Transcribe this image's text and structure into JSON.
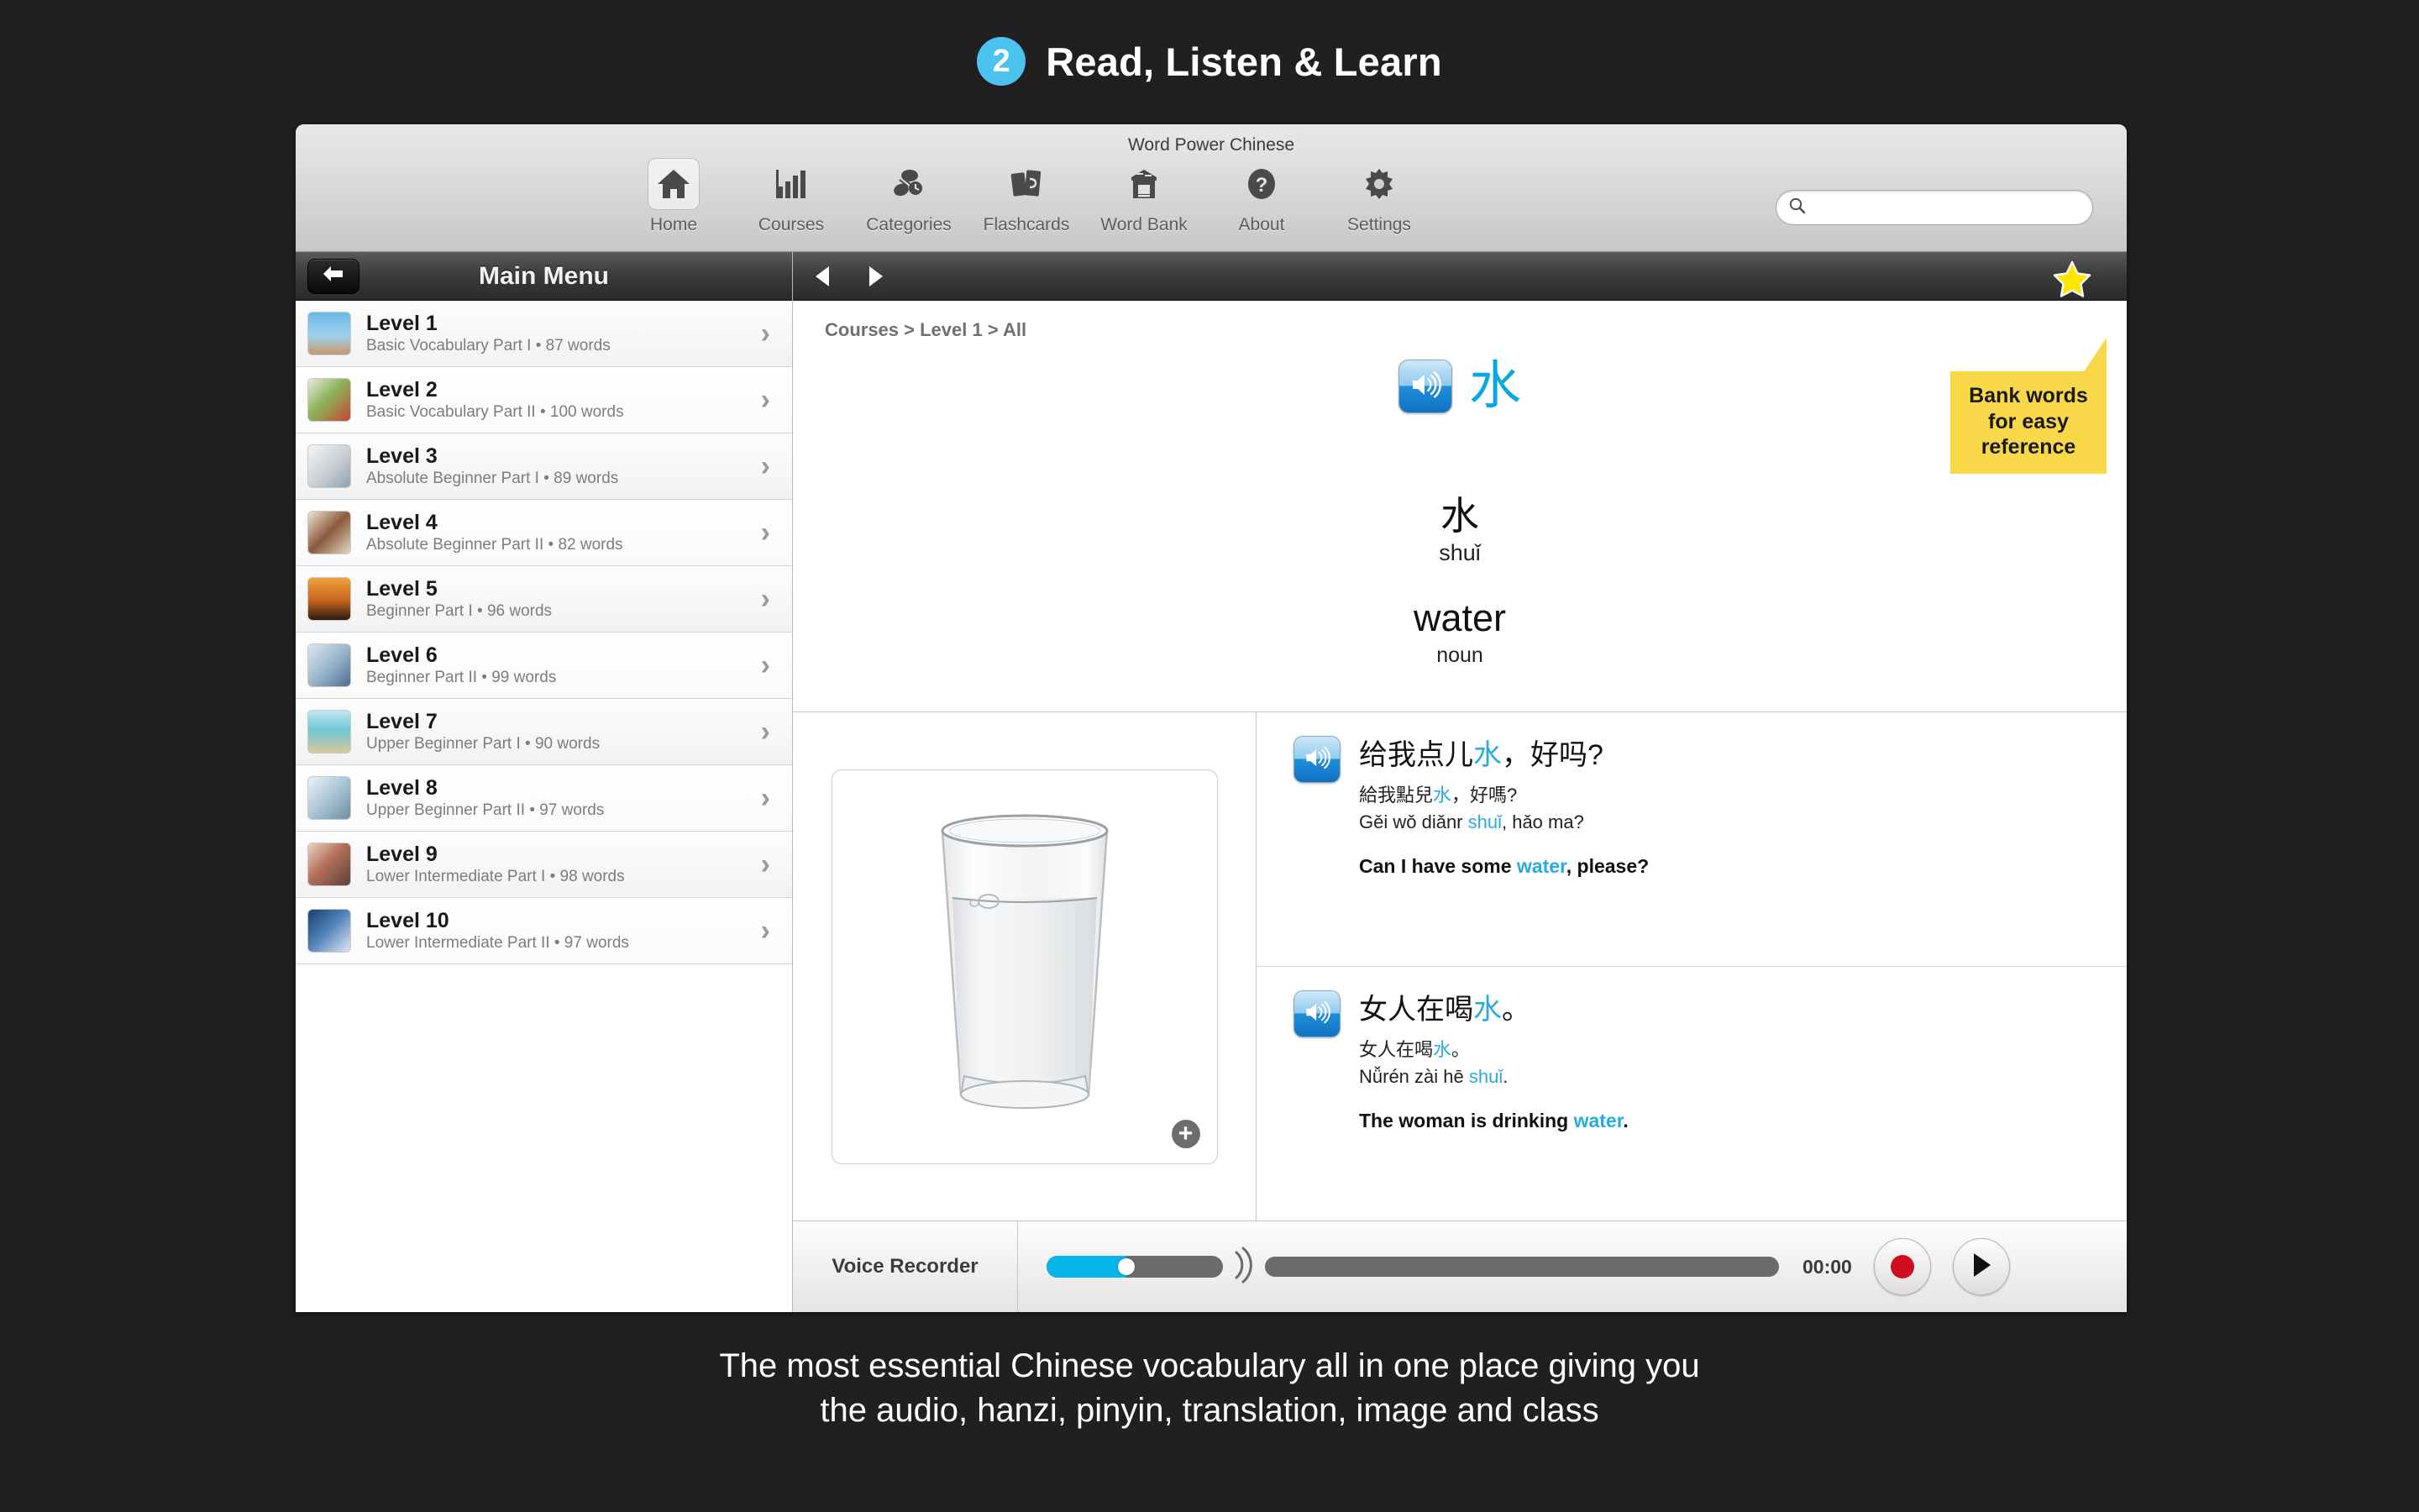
{
  "promo": {
    "step_number": "2",
    "title": "Read, Listen & Learn",
    "caption_line1": "The most essential Chinese vocabulary all in one place giving you",
    "caption_line2": "the audio, hanzi, pinyin, translation, image and class",
    "accent_color": "#4cc3ef",
    "background_color": "#211f1f"
  },
  "window": {
    "title": "Word Power Chinese"
  },
  "toolbar": {
    "items": [
      {
        "label": "Home",
        "icon": "home-icon",
        "selected": true
      },
      {
        "label": "Courses",
        "icon": "bar-chart-icon",
        "selected": false
      },
      {
        "label": "Categories",
        "icon": "categories-icon",
        "selected": false
      },
      {
        "label": "Flashcards",
        "icon": "flashcards-icon",
        "selected": false
      },
      {
        "label": "Word Bank",
        "icon": "word-bank-icon",
        "selected": false
      },
      {
        "label": "About",
        "icon": "question-icon",
        "selected": false
      },
      {
        "label": "Settings",
        "icon": "gear-icon",
        "selected": false
      }
    ],
    "search": {
      "value": "",
      "placeholder": "",
      "icon": "search-icon"
    }
  },
  "sidebar": {
    "title": "Main Menu",
    "back_icon": "back-arrow-icon",
    "levels": [
      {
        "title": "Level 1",
        "subtitle": "Basic Vocabulary Part I • 87 words",
        "thumb": "hurdler-photo"
      },
      {
        "title": "Level 2",
        "subtitle": "Basic Vocabulary Part II • 100 words",
        "thumb": "vegetables-photo"
      },
      {
        "title": "Level 3",
        "subtitle": "Absolute Beginner Part I • 89 words",
        "thumb": "keys-photo"
      },
      {
        "title": "Level 4",
        "subtitle": "Absolute Beginner Part II • 82 words",
        "thumb": "girl-brushing-teeth-photo"
      },
      {
        "title": "Level 5",
        "subtitle": "Beginner Part I • 96 words",
        "thumb": "sunset-photo"
      },
      {
        "title": "Level 6",
        "subtitle": "Beginner Part II • 99 words",
        "thumb": "remote-control-photo"
      },
      {
        "title": "Level 7",
        "subtitle": "Upper Beginner Part I • 90 words",
        "thumb": "beach-hammock-photo"
      },
      {
        "title": "Level 8",
        "subtitle": "Upper Beginner Part II • 97 words",
        "thumb": "laptop-photo"
      },
      {
        "title": "Level 9",
        "subtitle": "Lower Intermediate Part I • 98 words",
        "thumb": "people-party-photo"
      },
      {
        "title": "Level 10",
        "subtitle": "Lower Intermediate Part II • 97 words",
        "thumb": "runner-photo"
      }
    ],
    "chevron": "›"
  },
  "nav": {
    "prev_icon": "prev-arrow-icon",
    "next_icon": "next-arrow-icon",
    "star_icon": "star-icon",
    "star_color": "#ffe500"
  },
  "callout": {
    "line1": "Bank words",
    "line2": "for easy",
    "line3": "reference",
    "color": "#f8d848"
  },
  "main": {
    "breadcrumb": "Courses > Level 1 > All",
    "word": {
      "hanzi_headline": "水",
      "hanzi": "水",
      "pinyin": "shuǐ",
      "meaning": "water",
      "word_class": "noun",
      "audio_icon": "speaker-icon",
      "accent_color": "#0aa6e4"
    },
    "image": {
      "alt": "glass-of-water-photo",
      "zoom_label": "+"
    },
    "examples": [
      {
        "audio_icon": "speaker-icon",
        "simplified_pre": "给我点儿",
        "simplified_hl": "水",
        "simplified_post": "，好吗?",
        "traditional_pre": "給我點兒",
        "traditional_hl": "水",
        "traditional_post": "，好嗎?",
        "pinyin_pre": "Gěi wǒ diǎnr ",
        "pinyin_hl": "shuǐ",
        "pinyin_post": ", hǎo ma?",
        "english_pre": "Can I have some ",
        "english_hl": "water",
        "english_post": ", please?"
      },
      {
        "audio_icon": "speaker-icon",
        "simplified_pre": "女人在喝",
        "simplified_hl": "水",
        "simplified_post": "。",
        "traditional_pre": "女人在喝",
        "traditional_hl": "水",
        "traditional_post": "。",
        "pinyin_pre": "Nǚrén zài hē ",
        "pinyin_hl": "shuǐ",
        "pinyin_post": ".",
        "english_pre": "The woman is drinking ",
        "english_hl": "water",
        "english_post": "."
      }
    ]
  },
  "voice_recorder": {
    "label": "Voice Recorder",
    "volume_percent": 45,
    "progress_percent": 0,
    "time": "00:00",
    "record_icon": "record-icon",
    "play_icon": "play-icon",
    "record_color": "#d00d1f",
    "volume_color": "#06b6e8"
  }
}
